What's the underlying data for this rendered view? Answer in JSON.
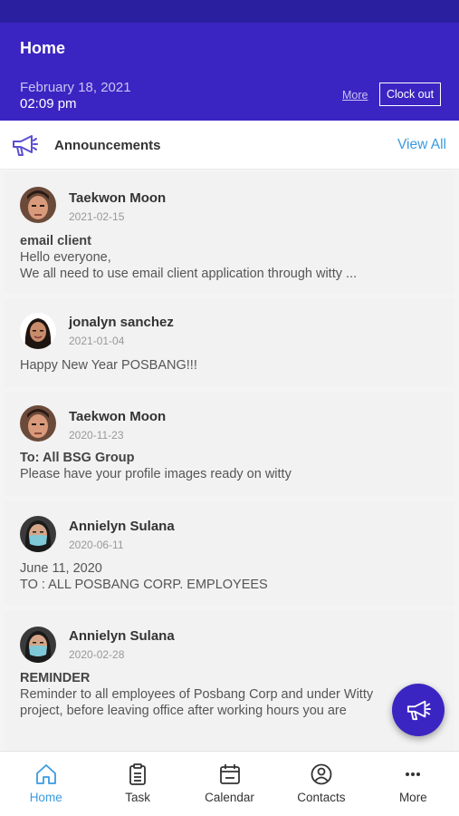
{
  "header": {
    "title": "Home",
    "date": "February 18, 2021",
    "time": "02:09 pm",
    "more_label": "More",
    "clockout_label": "Clock out"
  },
  "announcements": {
    "label": "Announcements",
    "view_all": "View All",
    "icon": "megaphone-icon"
  },
  "posts": [
    {
      "name": "Taekwon Moon",
      "date": "2021-02-15",
      "line1": "email client",
      "line2": "Hello everyone,",
      "line3": "We all need to use email client application through witty ..."
    },
    {
      "name": "jonalyn sanchez",
      "date": "2021-01-04",
      "line1": "Happy New Year POSBANG!!!"
    },
    {
      "name": "Taekwon Moon",
      "date": "2020-11-23",
      "line1": "To: All BSG Group",
      "line2": "Please have your profile images ready on witty"
    },
    {
      "name": "Annielyn Sulana",
      "date": "2020-06-11",
      "line1": "June 11, 2020",
      "line2": "TO : ALL POSBANG CORP. EMPLOYEES"
    },
    {
      "name": "Annielyn Sulana",
      "date": "2020-02-28",
      "line1": "REMINDER",
      "line2": "Reminder to all employees of Posbang Corp and under Witty",
      "line3": "project, before leaving office after working hours you are"
    }
  ],
  "tabs": [
    {
      "label": "Home",
      "icon": "home-icon",
      "active": true
    },
    {
      "label": "Task",
      "icon": "clipboard-icon"
    },
    {
      "label": "Calendar",
      "icon": "calendar-icon"
    },
    {
      "label": "Contacts",
      "icon": "person-circle-icon"
    },
    {
      "label": "More",
      "icon": "more-dots-icon"
    }
  ],
  "colors": {
    "header": "#3a25c2",
    "statusbar": "#2a1f9e",
    "accent": "#3a9be0"
  }
}
